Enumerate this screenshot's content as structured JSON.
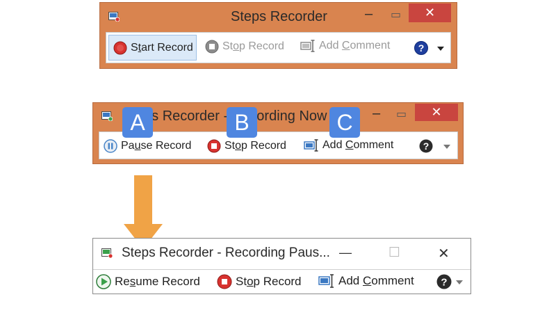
{
  "window1": {
    "title": "Steps Recorder",
    "buttons": {
      "start": {
        "before": "S",
        "ul": "t",
        "after": "art Record"
      },
      "stop": {
        "before": "St",
        "ul": "o",
        "after": "p Record"
      },
      "comment": {
        "before": "Add ",
        "ul": "C",
        "after": "omment"
      }
    },
    "close_glyph": "✕",
    "minimize_glyph": "–",
    "maximize_glyph": "▭"
  },
  "window2": {
    "title": "Steps Recorder - Recording Now",
    "buttons": {
      "pause": {
        "before": "Pa",
        "ul": "u",
        "after": "se Record"
      },
      "stop": {
        "before": "St",
        "ul": "o",
        "after": "p Record"
      },
      "comment": {
        "before": "Add ",
        "ul": "C",
        "after": "omment"
      }
    },
    "callouts": [
      "A",
      "B",
      "C"
    ],
    "close_glyph": "✕",
    "minimize_glyph": "–",
    "maximize_glyph": "▭"
  },
  "window3": {
    "title": "Steps Recorder - Recording Paus...",
    "buttons": {
      "resume": {
        "before": "Re",
        "ul": "s",
        "after": "ume Record"
      },
      "stop": {
        "before": "St",
        "ul": "o",
        "after": "p Record"
      },
      "comment": {
        "before": "Add ",
        "ul": "C",
        "after": "omment"
      }
    },
    "close_glyph": "✕",
    "minimize_glyph": "—",
    "maximize_glyph": "☐"
  },
  "colors": {
    "win8_frame": "#d9844f",
    "close_red": "#c9453f",
    "callout_blue": "#4f86e0",
    "arrow_orange": "#f0a346",
    "record_red": "#d8322f",
    "resume_green": "#3aa04a",
    "pause_blue": "#4a86c8"
  },
  "icons": [
    "steps-recorder-app-icon",
    "record-icon",
    "stop-icon",
    "pause-icon",
    "play-icon",
    "comment-icon",
    "help-icon",
    "dropdown-arrow-icon",
    "down-arrow"
  ]
}
